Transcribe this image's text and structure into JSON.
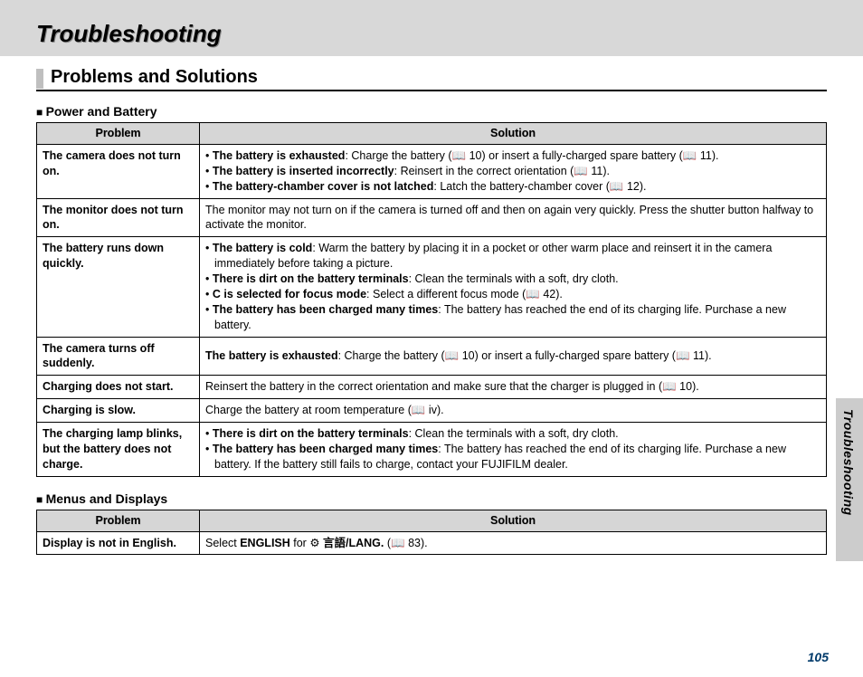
{
  "header": {
    "title": "Troubleshooting"
  },
  "section": {
    "title": "Problems and Solutions"
  },
  "sideLabel": "Troubleshooting",
  "pageNumber": "105",
  "columns": {
    "problem": "Problem",
    "solution": "Solution"
  },
  "tables": {
    "power": {
      "title": "Power and Battery",
      "rows": [
        {
          "problem": "The camera does not turn on.",
          "listed": true,
          "center": false,
          "items": [
            {
              "lead": "The battery is exhausted",
              "rest": ": Charge the battery (📖 10) or insert a fully-charged spare battery (📖 11)."
            },
            {
              "lead": "The battery is inserted incorrectly",
              "rest": ": Reinsert in the correct orientation (📖 11)."
            },
            {
              "lead": "The battery-chamber cover is not latched",
              "rest": ": Latch the battery-chamber cover (📖 12)."
            }
          ]
        },
        {
          "problem": "The monitor does not turn on.",
          "listed": false,
          "center": false,
          "plain": "The monitor may not turn on if the camera is turned off and then on again very quickly. Press the shutter button halfway to activate the monitor."
        },
        {
          "problem": "The battery runs down quickly.",
          "listed": true,
          "center": true,
          "items": [
            {
              "lead": "The battery is cold",
              "rest": ": Warm the battery by placing it in a pocket or other warm place and reinsert it in the camera immediately before taking a picture."
            },
            {
              "lead": "There is dirt on the battery terminals",
              "rest": ": Clean the terminals with a soft, dry cloth."
            },
            {
              "lead": "C is selected for focus mode",
              "rest": ": Select a different focus mode (📖 42)."
            },
            {
              "lead": "The battery has been charged many times",
              "rest": ": The battery has reached the end of its charging life.  Purchase a new battery."
            }
          ]
        },
        {
          "problem": "The camera turns off suddenly.",
          "listed": false,
          "center": true,
          "boldlead": "The battery is exhausted",
          "plain": ": Charge the battery (📖 10) or insert a fully-charged spare battery (📖 11)."
        },
        {
          "problem": "Charging does not start.",
          "listed": false,
          "center": false,
          "plain": "Reinsert the battery in the correct orientation and make sure that the charger is plugged in (📖 10)."
        },
        {
          "problem": "Charging is slow.",
          "listed": false,
          "center": false,
          "plain": "Charge the battery at room temperature (📖 iv)."
        },
        {
          "problem": "The charging lamp blinks, but the battery does not charge.",
          "listed": true,
          "center": false,
          "items": [
            {
              "lead": "There is dirt on the battery terminals",
              "rest": ": Clean the terminals with a soft, dry cloth."
            },
            {
              "lead": "The battery has been charged many times",
              "rest": ": The battery has reached the end of its charging life.  Purchase a new battery.  If the battery still fails to charge, contact your FUJIFILM dealer."
            }
          ]
        }
      ]
    },
    "menus": {
      "title": "Menus and Displays",
      "rows": [
        {
          "problem": "Display is not in English.",
          "listed": false,
          "center": false,
          "rich": {
            "pre": "Select ",
            "bold1": "ENGLISH",
            "mid": " for ",
            "icon": "⚙",
            "lang": " 言語/LANG.",
            "post": " (📖 83)."
          }
        }
      ]
    }
  }
}
